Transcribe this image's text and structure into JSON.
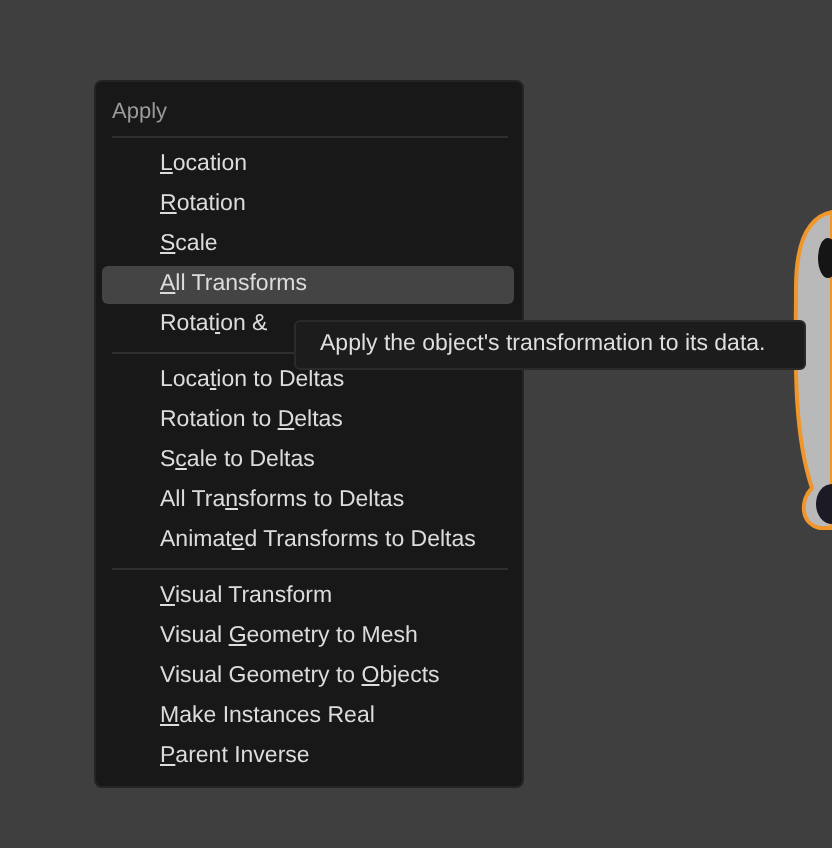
{
  "menu": {
    "title": "Apply",
    "sections": [
      {
        "items": [
          {
            "key": "L",
            "after": "ocation",
            "selected": false
          },
          {
            "key": "R",
            "after": "otation",
            "selected": false
          },
          {
            "key": "S",
            "after": "cale",
            "selected": false
          },
          {
            "key": "A",
            "after": "ll Transforms",
            "selected": true
          },
          {
            "before": "Rotat",
            "key": "i",
            "after": "on &",
            "selected": false
          }
        ]
      },
      {
        "items": [
          {
            "before": "Loca",
            "key": "t",
            "after": "ion to Deltas",
            "selected": false
          },
          {
            "before": "Rotation to ",
            "key": "D",
            "after": "eltas",
            "selected": false
          },
          {
            "before": "S",
            "key": "c",
            "after": "ale to Deltas",
            "selected": false
          },
          {
            "before": "All Tra",
            "key": "n",
            "after": "sforms to Deltas",
            "selected": false
          },
          {
            "before": "Animat",
            "key": "e",
            "after": "d Transforms to Deltas",
            "selected": false
          }
        ]
      },
      {
        "items": [
          {
            "key": "V",
            "after": "isual Transform",
            "selected": false
          },
          {
            "before": "Visual ",
            "key": "G",
            "after": "eometry to Mesh",
            "selected": false
          },
          {
            "before": "Visual Geometry to ",
            "key": "O",
            "after": "bjects",
            "selected": false
          },
          {
            "key": "M",
            "after": "ake Instances Real",
            "selected": false
          },
          {
            "key": "P",
            "after": "arent Inverse",
            "selected": false
          }
        ]
      }
    ]
  },
  "tooltip": {
    "text": "Apply the object's transformation to its data."
  }
}
